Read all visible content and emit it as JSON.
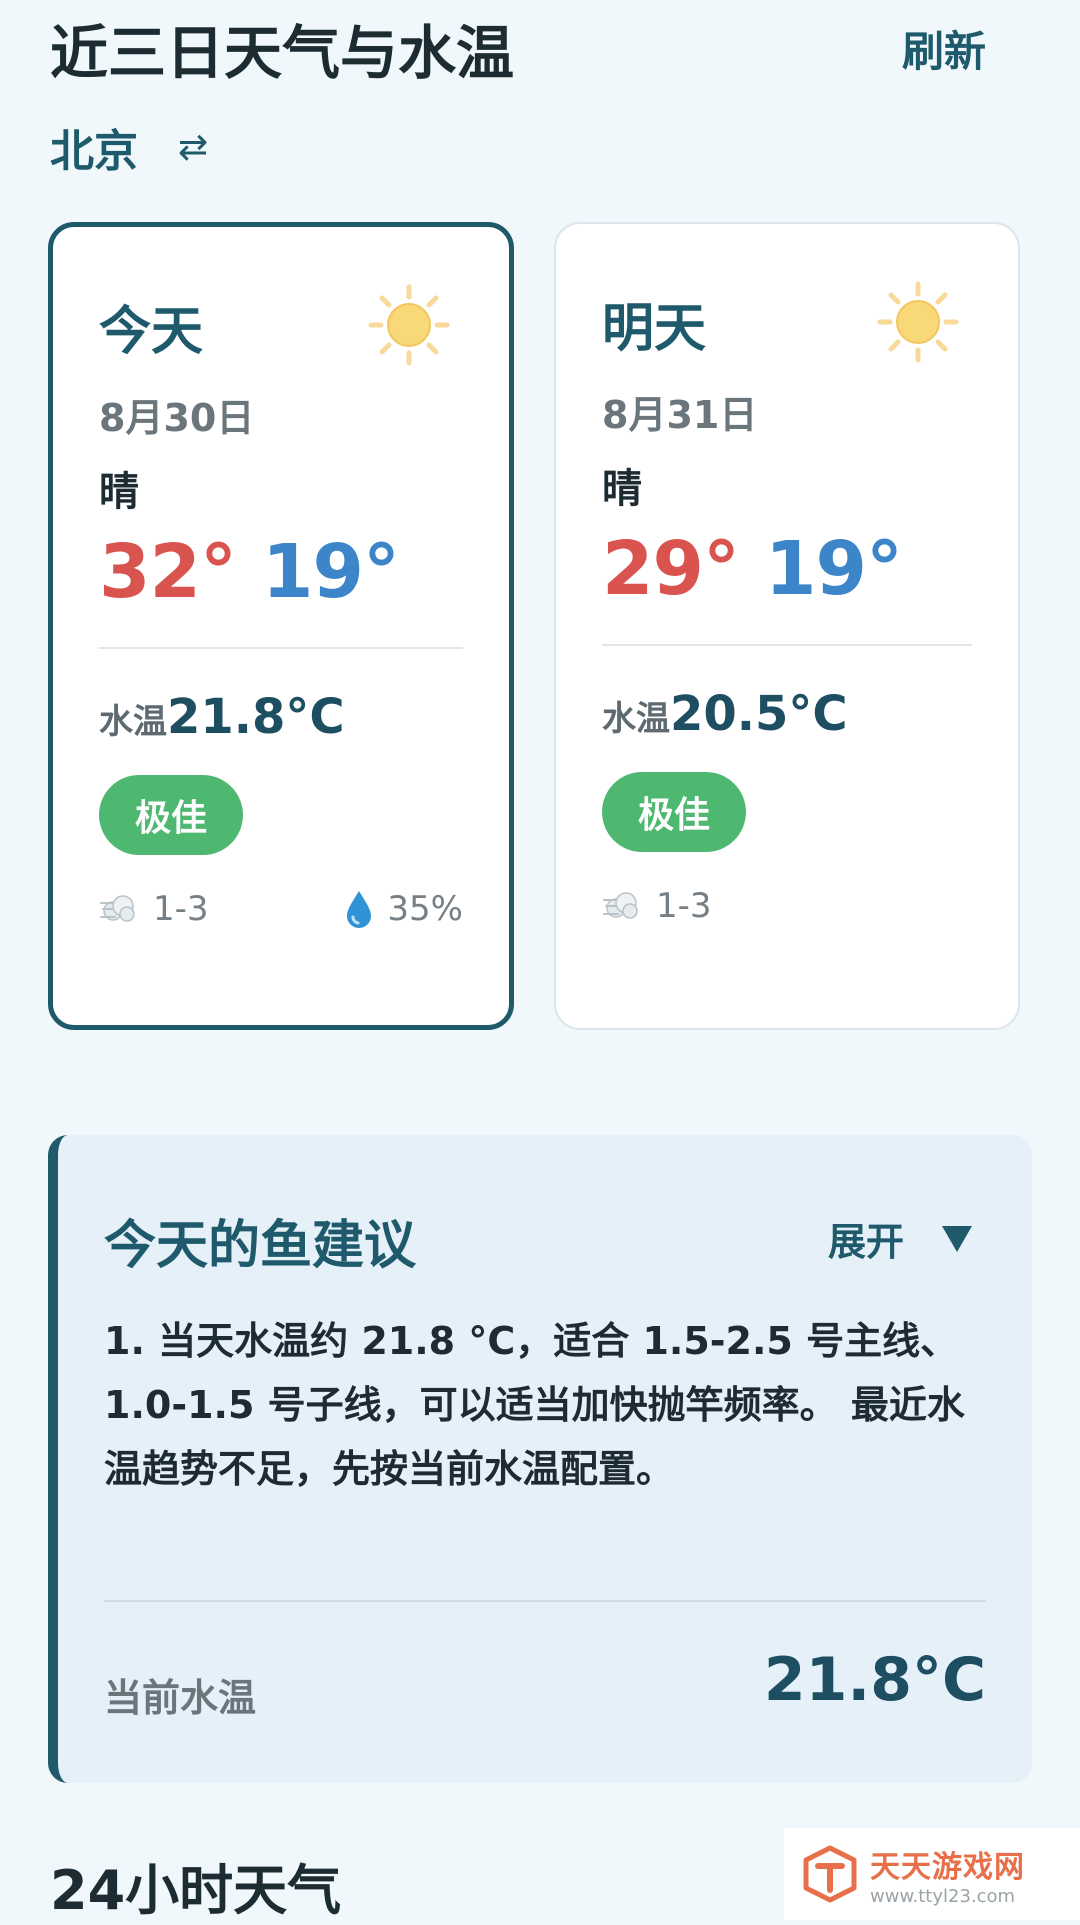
{
  "header": {
    "title": "近三日天气与水温",
    "refresh_label": "刷新"
  },
  "location": {
    "city": "北京",
    "swap_icon": "swap-arrows-icon",
    "swap_glyph": "⇄"
  },
  "forecast": [
    {
      "day": "今天",
      "date": "8月30日",
      "condition": "晴",
      "condition_icon": "sun-icon",
      "high": "32°",
      "low": "19°",
      "water_label": "水温",
      "water_temp": "21.8°C",
      "rating": "极佳",
      "wind_icon": "wind-icon",
      "wind": "1-3",
      "humidity_icon": "water-drop-icon",
      "humidity": "35%",
      "selected": true
    },
    {
      "day": "明天",
      "date": "8月31日",
      "condition": "晴",
      "condition_icon": "sun-icon",
      "high": "29°",
      "low": "19°",
      "water_label": "水温",
      "water_temp": "20.5°C",
      "rating": "极佳",
      "wind_icon": "wind-icon",
      "wind": "1-3",
      "selected": false
    }
  ],
  "tips": {
    "title": "今天的鱼建议",
    "expand_label": "展开",
    "expand_icon": "caret-down-icon",
    "body": "1. 当天水温约 21.8 °C，适合 1.5-2.5 号主线、1.0-1.5 号子线，可以适当加快抛竿频率。 最近水温趋势不足，先按当前水温配置。",
    "current_label": "当前水温",
    "current_value": "21.8°C"
  },
  "hourly": {
    "title": "24小时天气"
  },
  "watermark": {
    "name": "天天游戏网",
    "url": "www.ttyl23.com"
  },
  "colors": {
    "accent": "#1f5a6b",
    "high_temp": "#d9534f",
    "low_temp": "#3c85c9",
    "badge": "#4fb870",
    "background": "#f1f8fc",
    "tips_background": "#e6f0f8"
  }
}
